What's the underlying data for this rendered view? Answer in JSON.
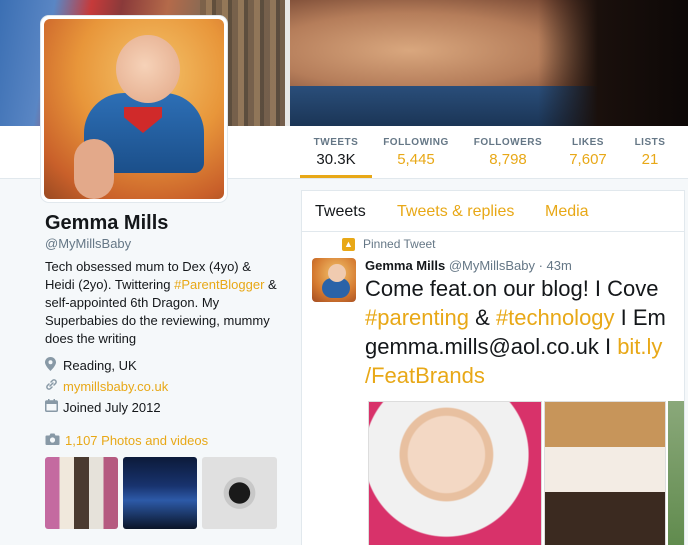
{
  "profile": {
    "name": "Gemma Mills",
    "handle": "@MyMillsBaby",
    "bio_pre": "Tech obsessed mum to Dex (4yo) & Heidi (2yo). Twittering ",
    "bio_hashtag": "#ParentBlogger",
    "bio_post": " & self-appointed 6th Dragon. My Superbabies do the reviewing, mummy does the writing",
    "location": "Reading, UK",
    "website": "mymillsbaby.co.uk",
    "joined": "Joined July 2012",
    "photos_link": "1,107 Photos and videos"
  },
  "stats": [
    {
      "label": "TWEETS",
      "value": "30.3K"
    },
    {
      "label": "FOLLOWING",
      "value": "5,445"
    },
    {
      "label": "FOLLOWERS",
      "value": "8,798"
    },
    {
      "label": "LIKES",
      "value": "7,607"
    },
    {
      "label": "LISTS",
      "value": "21"
    }
  ],
  "tabs": [
    "Tweets",
    "Tweets & replies",
    "Media"
  ],
  "tweet": {
    "pinned_label": "Pinned Tweet",
    "name": "Gemma Mills",
    "handle": "@MyMillsBaby",
    "time": "· 43m",
    "line1": "Come feat.on our blog! I Cove",
    "hashtag1": "#parenting",
    "amp": " & ",
    "hashtag2": "#technology",
    "line2_tail": " I Em",
    "line3_text": "gemma.mills@aol.co.uk I ",
    "line3_link": "bit.ly",
    "line4": "/FeatBrands"
  },
  "colors": {
    "accent": "#e8a817",
    "text": "#14171a",
    "muted": "#657786"
  },
  "icons": {
    "location": "map-pin-icon",
    "website": "link-icon",
    "joined": "calendar-icon",
    "photos": "camera-icon",
    "pinned": "pin-icon"
  }
}
